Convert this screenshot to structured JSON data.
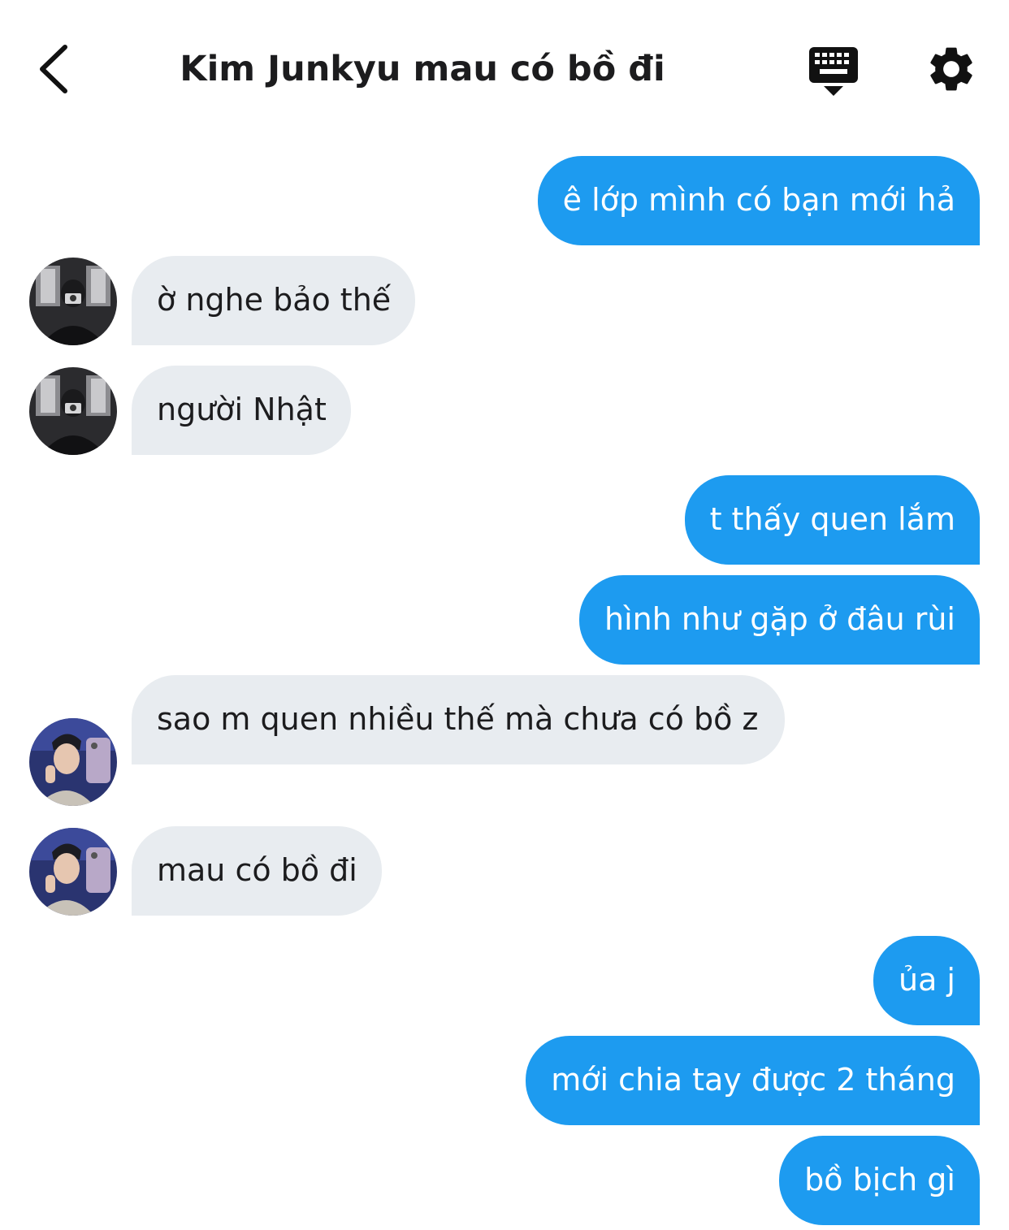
{
  "header": {
    "title": "Kim Junkyu mau có bồ đi",
    "back_icon": "chevron-left-icon",
    "keyboard_icon": "keyboard-icon",
    "settings_icon": "gear-icon"
  },
  "colors": {
    "outgoing_bubble": "#1d9bf0",
    "incoming_bubble": "#e8ecf0",
    "text_dark": "#1c1c1e"
  },
  "messages": [
    {
      "direction": "outgoing",
      "text": "ê lớp mình có bạn mới hả"
    },
    {
      "direction": "incoming",
      "avatar": "avatar-user-a",
      "text": "ờ nghe bảo thế"
    },
    {
      "direction": "incoming",
      "avatar": "avatar-user-a",
      "text": "người Nhật"
    },
    {
      "direction": "outgoing",
      "text": "t thấy quen lắm"
    },
    {
      "direction": "outgoing",
      "text": "hình như gặp ở đâu rùi"
    },
    {
      "direction": "incoming",
      "avatar": "avatar-user-b",
      "text": "sao m quen nhiều thế mà chưa có bồ z"
    },
    {
      "direction": "incoming",
      "avatar": "avatar-user-b",
      "text": "mau có bồ đi"
    },
    {
      "direction": "outgoing",
      "text": "ủa j"
    },
    {
      "direction": "outgoing",
      "text": "mới chia tay được 2 tháng"
    },
    {
      "direction": "outgoing",
      "text": "bồ bịch gì"
    }
  ]
}
